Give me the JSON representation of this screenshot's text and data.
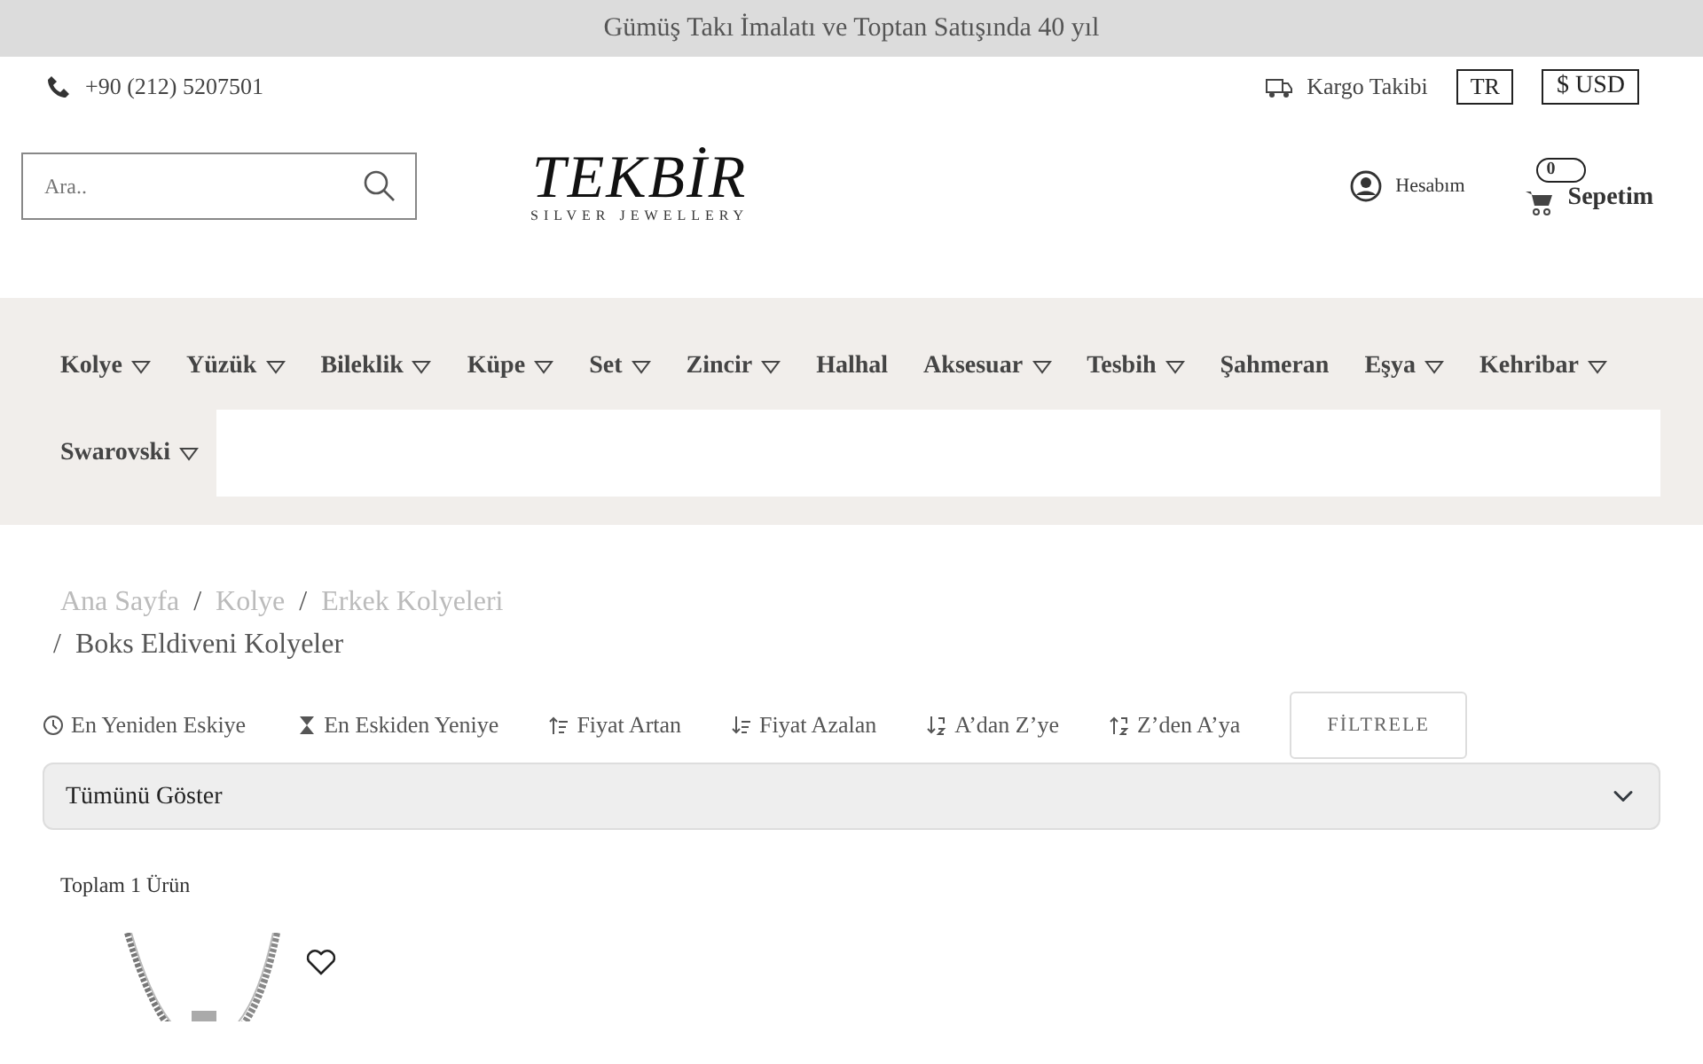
{
  "announcement": "Gümüş Takı İmalatı ve Toptan Satışında 40 yıl",
  "phone": "+90 (212) 5207501",
  "top_links": {
    "tracking": "Kargo Takibi",
    "language": "TR",
    "currency": "$ USD"
  },
  "search": {
    "placeholder": "Ara.."
  },
  "logo": {
    "name": "TEKBİR",
    "tagline": "SILVER JEWELLERY"
  },
  "account": "Hesabım",
  "cart": {
    "count": "0",
    "label": "Sepetim"
  },
  "menu": [
    {
      "label": "Kolye",
      "has_submenu": true
    },
    {
      "label": "Yüzük",
      "has_submenu": true
    },
    {
      "label": "Bileklik",
      "has_submenu": true
    },
    {
      "label": "Küpe",
      "has_submenu": true
    },
    {
      "label": "Set",
      "has_submenu": true
    },
    {
      "label": "Zincir",
      "has_submenu": true
    },
    {
      "label": "Halhal",
      "has_submenu": false
    },
    {
      "label": "Aksesuar",
      "has_submenu": true
    },
    {
      "label": "Tesbih",
      "has_submenu": true
    },
    {
      "label": "Şahmeran",
      "has_submenu": false
    },
    {
      "label": "Eşya",
      "has_submenu": true
    },
    {
      "label": "Kehribar",
      "has_submenu": true
    },
    {
      "label": "Swarovski",
      "has_submenu": true
    }
  ],
  "breadcrumb": [
    {
      "label": "Ana Sayfa",
      "current": false
    },
    {
      "separator": "/",
      "label": "Kolye",
      "current": false
    },
    {
      "separator": "/",
      "label": "Erkek Kolyeleri",
      "current": false
    },
    {
      "separator": "/",
      "label": "Boks Eldiveni Kolyeler",
      "current": true
    }
  ],
  "sort_options": [
    {
      "kind": "clock",
      "label": "En Yeniden Eskiye"
    },
    {
      "kind": "hourglass",
      "label": "En Eskiden Yeniye"
    },
    {
      "kind": "up",
      "label": "Fiyat Artan"
    },
    {
      "kind": "down",
      "label": "Fiyat Azalan"
    },
    {
      "kind": "az",
      "label": "A’dan Z’ye"
    },
    {
      "kind": "za",
      "label": "Z’den A’ya"
    }
  ],
  "filter_button": "FİLTRELE",
  "show_select": {
    "value": "Tümünü Göster"
  },
  "total": "Toplam 1 Ürün"
}
